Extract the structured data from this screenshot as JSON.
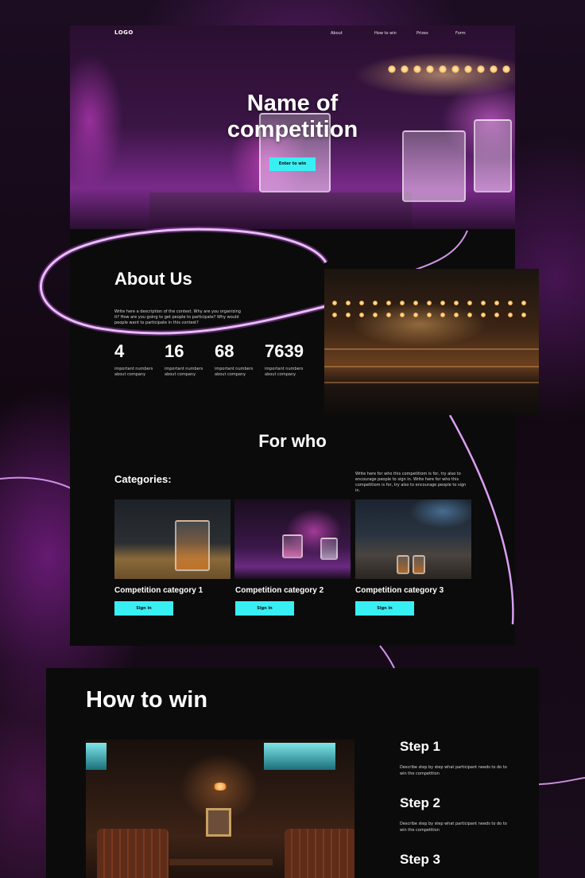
{
  "header": {
    "logo": "LOGO",
    "nav": [
      "About",
      "How to win",
      "Prizes",
      "Form"
    ]
  },
  "hero": {
    "title_line1": "Name of",
    "title_line2": "competition",
    "cta_label": "Enter to win"
  },
  "about": {
    "title": "About Us",
    "description": "Write here a description of the contest. Why are you organizing it? How are you going to get people to participate? Why would people want to participate in this contest?",
    "stats": [
      {
        "value": "4",
        "label": "important numbers about company"
      },
      {
        "value": "16",
        "label": "important numbers about company"
      },
      {
        "value": "68",
        "label": "important numbers about company"
      },
      {
        "value": "7639",
        "label": "important numbers about company"
      }
    ]
  },
  "for_who": {
    "title": "For who",
    "categories_heading": "Categories:",
    "description": "Write here for who this competitiom is for, try also to encourage people to sign in. Write here for who this competitiom is for, try also to encourage people to sign in.",
    "categories": [
      {
        "title": "Competition category 1",
        "button": "Sign in"
      },
      {
        "title": "Competition category 2",
        "button": "Sign in"
      },
      {
        "title": "Competition category 3",
        "button": "Sign in"
      }
    ]
  },
  "how_to_win": {
    "title": "How to win",
    "steps": [
      {
        "title": "Step 1",
        "description": "Describe step by step what participant needs to do to win the competition"
      },
      {
        "title": "Step 2",
        "description": "Describe step by step what participant needs to do to win the competition"
      },
      {
        "title": "Step 3",
        "description": ""
      }
    ]
  },
  "colors": {
    "accent_cyan": "#38f0f4",
    "card_background": "#0b0b0b",
    "neon_purple": "#d85cff"
  }
}
